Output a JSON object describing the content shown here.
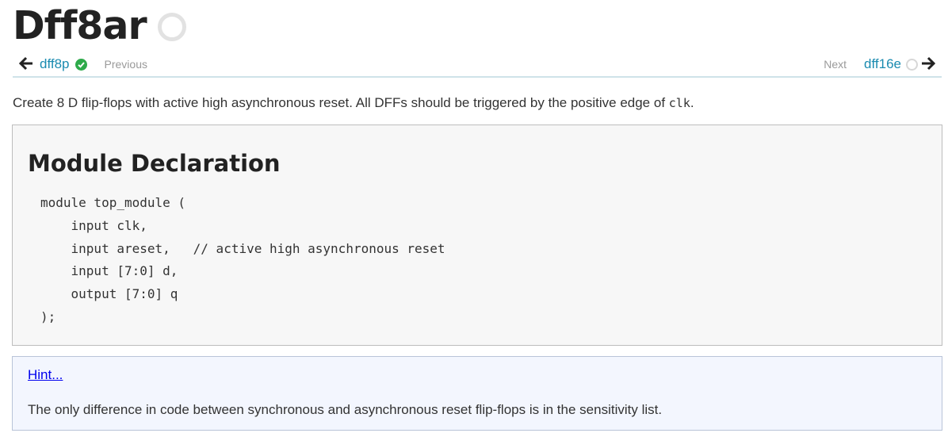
{
  "page": {
    "title": "Dff8ar",
    "status_icon": "incomplete-circle-icon"
  },
  "nav": {
    "back_arrow": "🡐",
    "prev_problem": "dff8p",
    "prev_status_icon": "check-circle-icon",
    "prev_label": "Previous",
    "next_label": "Next",
    "next_problem": "dff16e",
    "next_status_icon": "empty-circle-icon",
    "forward_arrow": "🡒"
  },
  "intro": {
    "text_before": "Create 8 D flip-flops with active high asynchronous reset. All DFFs should be triggered by the positive edge of ",
    "code": "clk",
    "text_after": "."
  },
  "module_declaration": {
    "heading": "Module Declaration",
    "code_lines": [
      "module top_module (",
      "    input clk,",
      "    input areset,   // active high asynchronous reset",
      "    input [7:0] d,",
      "    output [7:0] q",
      ");"
    ]
  },
  "hint": {
    "link_label": "Hint...",
    "text": "The only difference in code between synchronous and asynchronous reset flip-flops is in the sensitivity list."
  },
  "colors": {
    "accent_link": "#1a8bb0",
    "check_green": "#2eaa4a",
    "nav_rule": "#cfe3e9",
    "hint_bg": "#f3f6fe"
  }
}
